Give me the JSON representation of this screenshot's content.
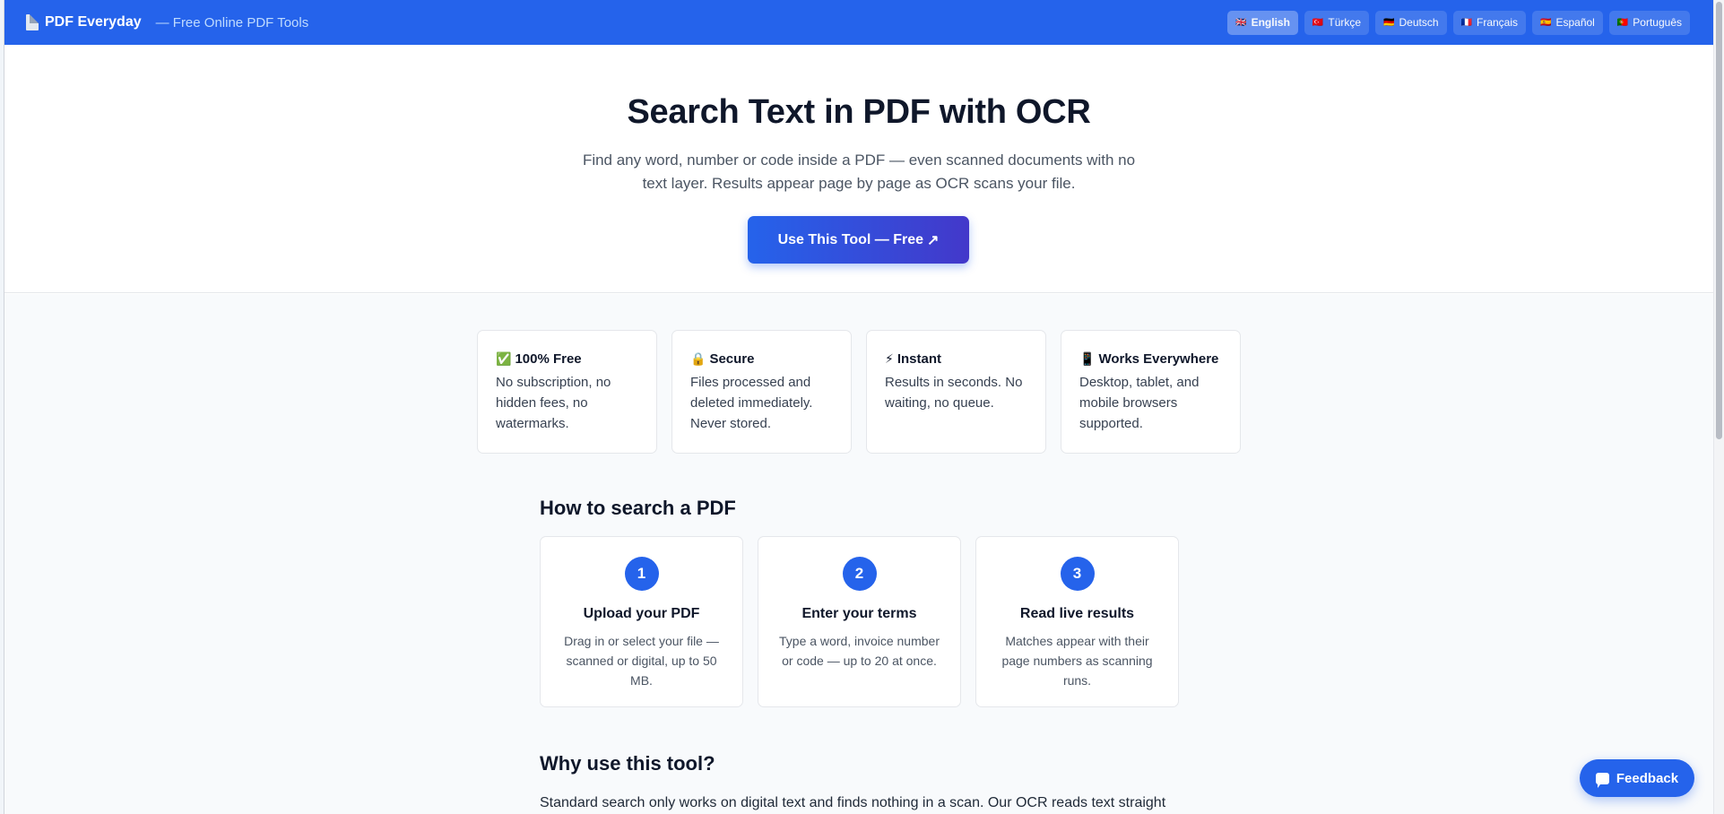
{
  "header": {
    "brand_name": "PDF Everyday",
    "tagline": "— Free Online PDF Tools",
    "languages": [
      {
        "flag": "🇬🇧",
        "label": "English",
        "active": true
      },
      {
        "flag": "🇹🇷",
        "label": "Türkçe",
        "active": false
      },
      {
        "flag": "🇩🇪",
        "label": "Deutsch",
        "active": false
      },
      {
        "flag": "🇫🇷",
        "label": "Français",
        "active": false
      },
      {
        "flag": "🇪🇸",
        "label": "Español",
        "active": false
      },
      {
        "flag": "🇵🇹",
        "label": "Português",
        "active": false
      }
    ]
  },
  "hero": {
    "title": "Search Text in PDF with OCR",
    "subtitle": "Find any word, number or code inside a PDF — even scanned documents with no text layer. Results appear page by page as OCR scans your file.",
    "cta_label": "Use This Tool — Free",
    "cta_icon": "↗"
  },
  "features": [
    {
      "icon": "✅",
      "title": "100% Free",
      "text": "No subscription, no hidden fees, no watermarks."
    },
    {
      "icon": "🔒",
      "title": "Secure",
      "text": "Files processed and deleted immediately. Never stored."
    },
    {
      "icon": "⚡",
      "title": "Instant",
      "text": "Results in seconds. No waiting, no queue."
    },
    {
      "icon": "📱",
      "title": "Works Everywhere",
      "text": "Desktop, tablet, and mobile browsers supported."
    }
  ],
  "how_to": {
    "title": "How to search a PDF",
    "steps": [
      {
        "number": "1",
        "title": "Upload your PDF",
        "text": "Drag in or select your file — scanned or digital, up to 50 MB."
      },
      {
        "number": "2",
        "title": "Enter your terms",
        "text": "Type a word, invoice number or code — up to 20 at once."
      },
      {
        "number": "3",
        "title": "Read live results",
        "text": "Matches appear with their page numbers as scanning runs."
      }
    ]
  },
  "why": {
    "title": "Why use this tool?",
    "text": "Standard search only works on digital text and finds nothing in a scan. Our OCR reads text straight"
  },
  "feedback": {
    "label": "Feedback"
  },
  "colors": {
    "primary": "#2563eb",
    "cta_end": "#4338ca",
    "page_bg": "#f8fafc"
  }
}
